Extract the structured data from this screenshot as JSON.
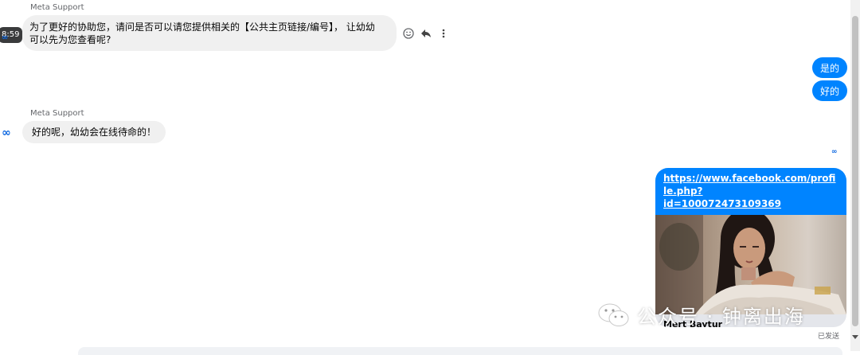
{
  "messages": [
    {
      "sender": "Meta Support",
      "text_line1": "为了更好的协助您，请问是否可以请您提供相关的【公共主页链接/编号】， 让幼幼",
      "text_line2": "可以先为您查看呢?",
      "time": "8:59"
    },
    {
      "outgoing": "是的"
    },
    {
      "outgoing": "好的"
    },
    {
      "sender": "Meta Support",
      "text": "好的呢，幼幼会在线待命的！"
    }
  ],
  "avatar_icon": "meta-logo-icon",
  "link_message": {
    "url_line1": "https://www.facebook.com/profile.php?",
    "url_line2": "id=100072473109369",
    "profile_name": "Mert Baytur",
    "status": "已发送"
  },
  "watermark": {
    "text": "公众号 · 钟离出海",
    "icon": "wechat-icon"
  },
  "colors": {
    "outgoing_bubble": "#0084ff",
    "incoming_bubble": "#f0f0f0",
    "meta_blue": "#0a66e0"
  }
}
